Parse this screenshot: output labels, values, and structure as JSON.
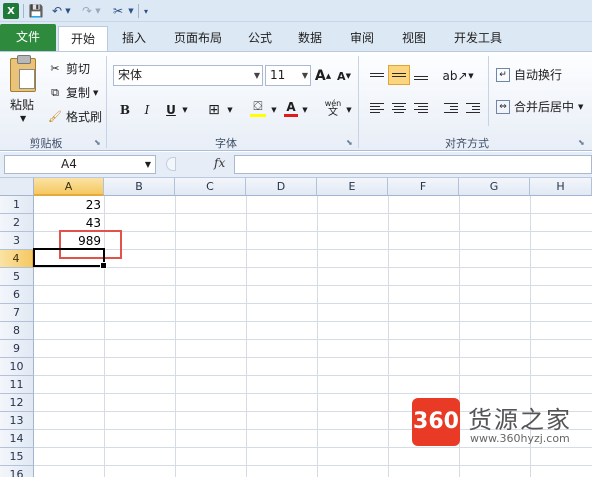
{
  "qat": {
    "app_icon": "X",
    "save_icon": "save-icon",
    "undo_icon": "undo-icon",
    "redo_icon": "redo-icon",
    "tools_icon": "tools-icon"
  },
  "tabs": [
    "文件",
    "开始",
    "插入",
    "页面布局",
    "公式",
    "数据",
    "审阅",
    "视图",
    "开发工具"
  ],
  "ribbon": {
    "clipboard": {
      "paste": "粘贴",
      "cut": "剪切",
      "copy": "复制",
      "format_painter": "格式刷",
      "label": "剪贴板"
    },
    "font": {
      "font_name": "宋体",
      "font_size": "11",
      "bold": "B",
      "italic": "I",
      "underline": "U",
      "label": "字体"
    },
    "alignment": {
      "wrap_text": "自动换行",
      "merge_center": "合并后居中",
      "label": "对齐方式"
    }
  },
  "formula_bar": {
    "name_box": "A4",
    "fx": "fx",
    "formula": ""
  },
  "sheet": {
    "columns": [
      "A",
      "B",
      "C",
      "D",
      "E",
      "F",
      "G",
      "H"
    ],
    "rows": [
      "1",
      "2",
      "3",
      "4",
      "5",
      "6",
      "7",
      "8",
      "9",
      "10",
      "11",
      "12",
      "13",
      "14",
      "15",
      "16"
    ],
    "cells": {
      "A1": "23",
      "A2": "43",
      "A3": "989"
    },
    "selected_column": "A",
    "selected_row": "4"
  },
  "watermark": {
    "badge": "360",
    "title": "货源之家",
    "url": "www.360hyzj.com"
  },
  "colors": {
    "file_tab": "#2e8b3d",
    "highlight_box": "#e0524a",
    "selection": "#f5c862",
    "watermark_badge": "#e83a25"
  }
}
